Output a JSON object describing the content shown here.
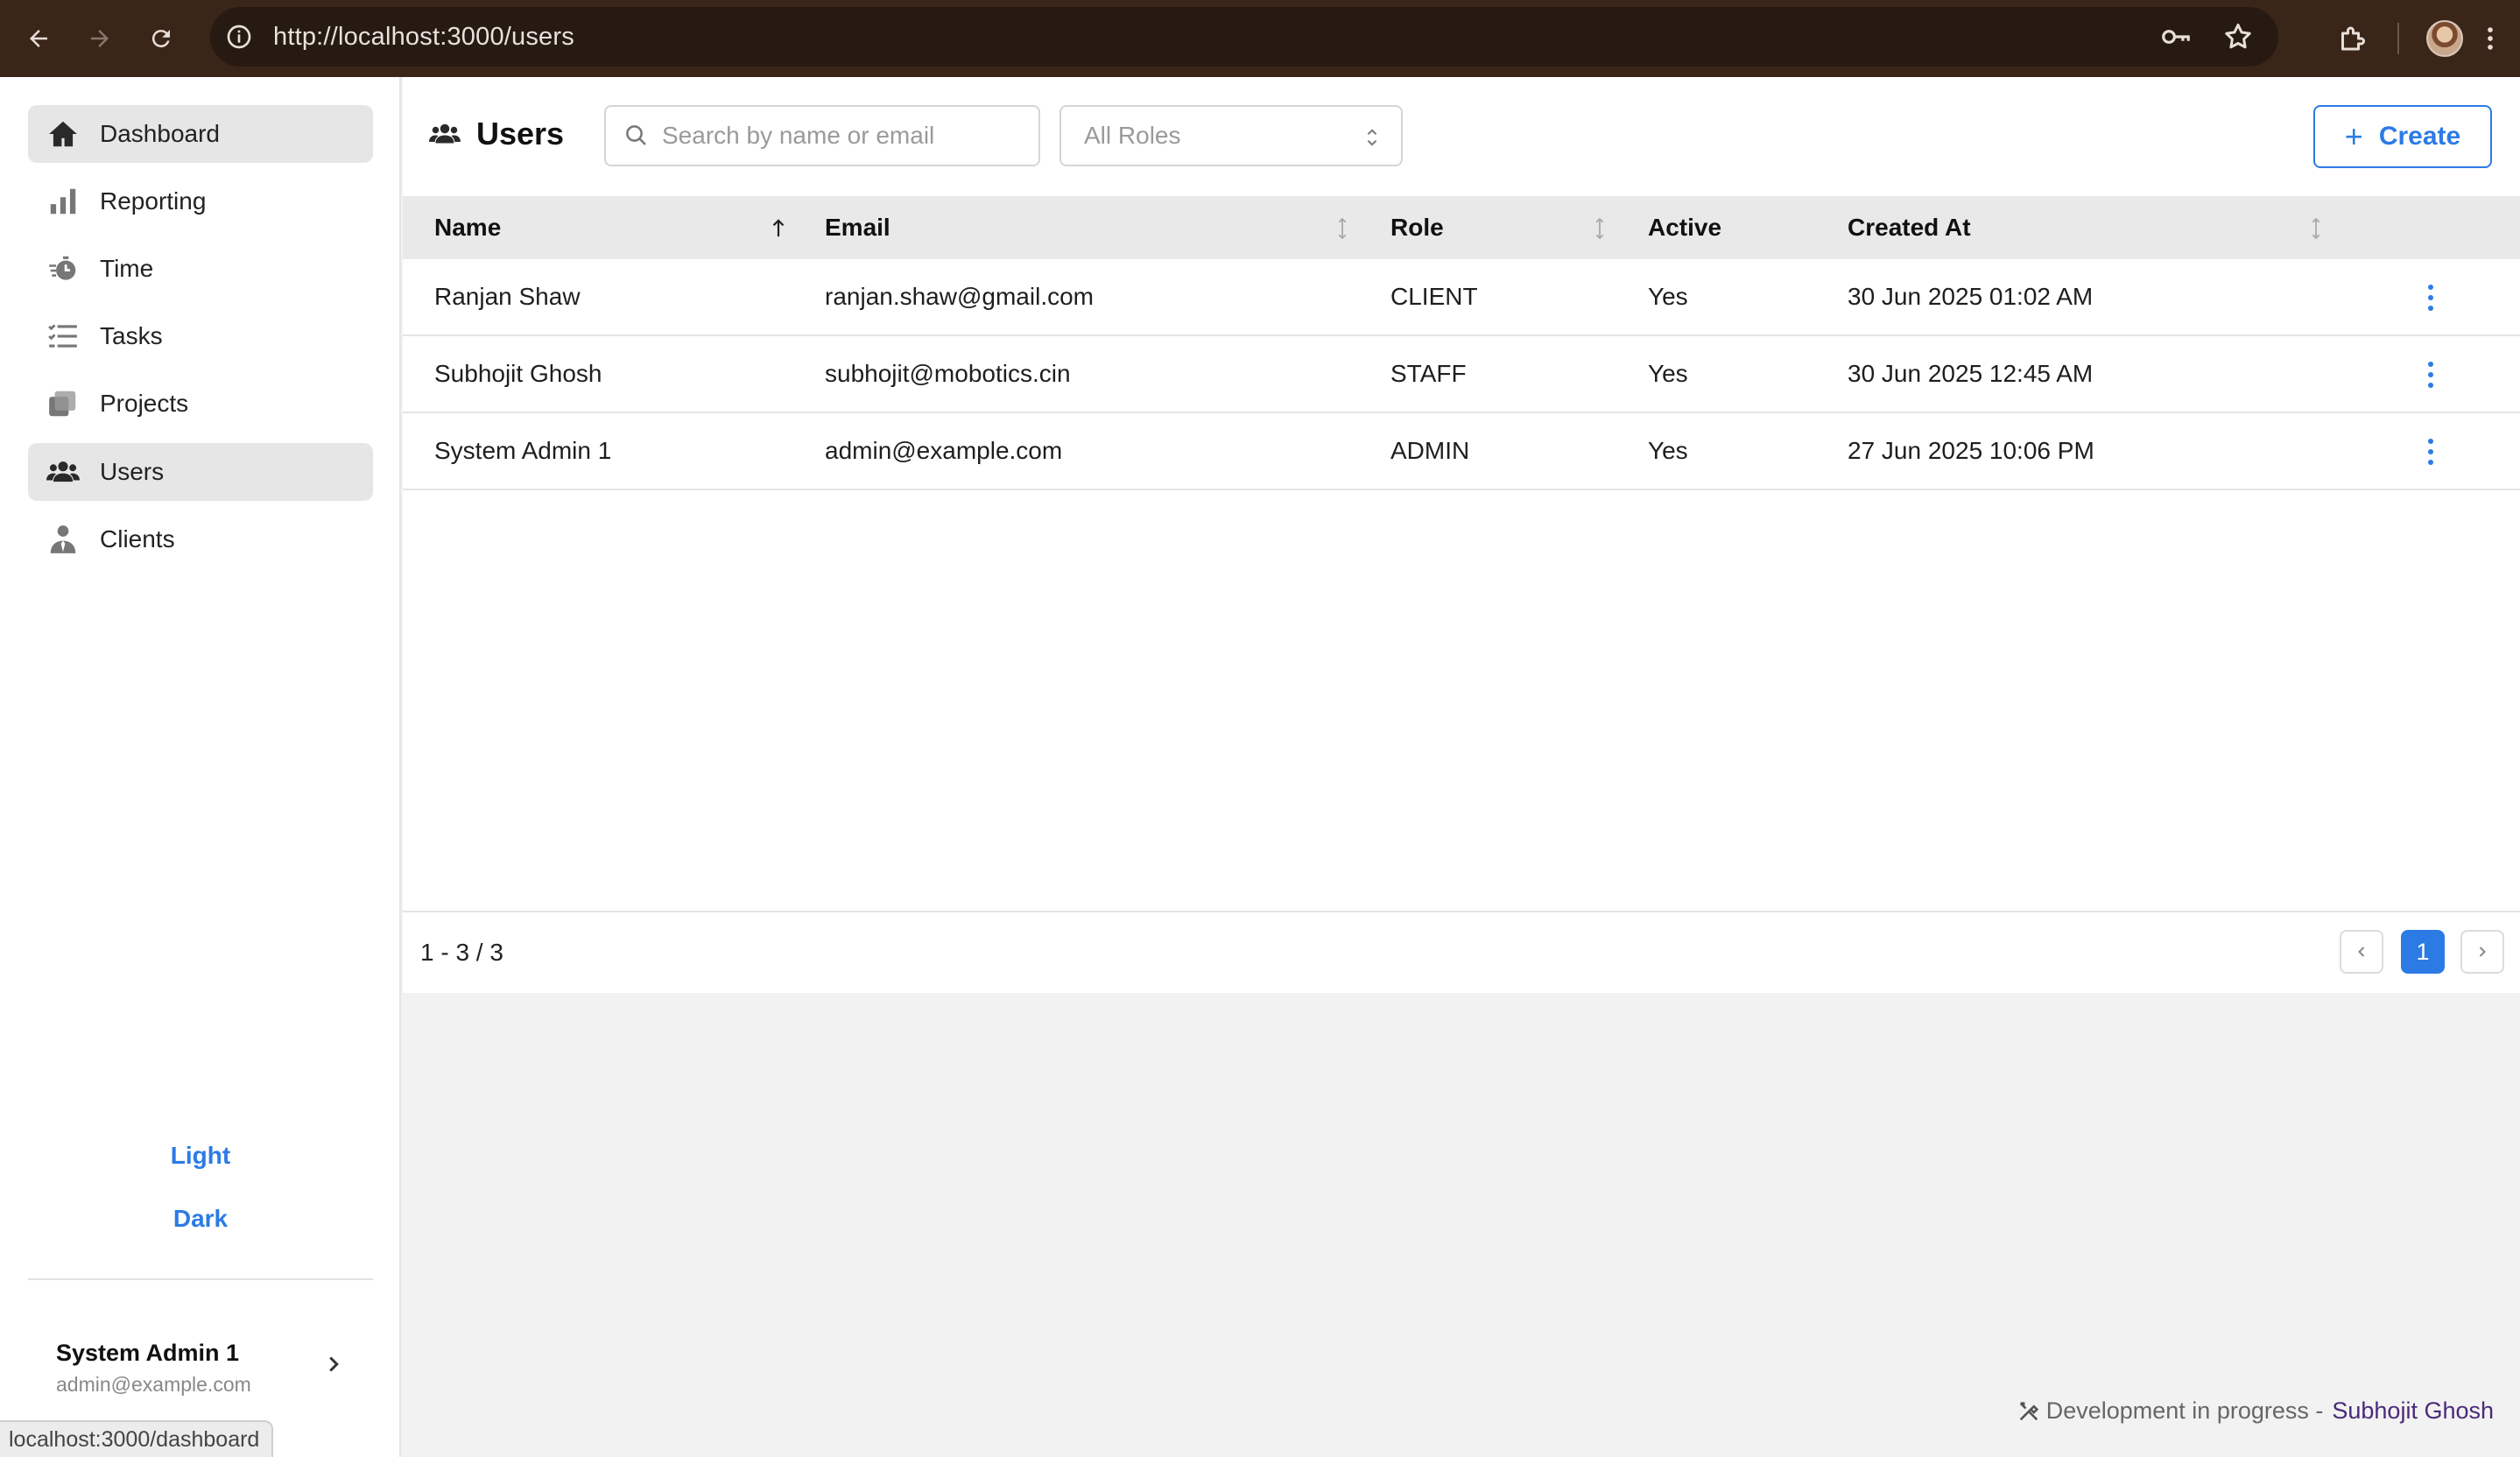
{
  "browser": {
    "url": "http://localhost:3000/users",
    "status_url": "localhost:3000/dashboard"
  },
  "sidebar": {
    "items": [
      {
        "label": "Dashboard",
        "icon": "home-icon"
      },
      {
        "label": "Reporting",
        "icon": "bar-chart-icon"
      },
      {
        "label": "Time",
        "icon": "stopwatch-icon"
      },
      {
        "label": "Tasks",
        "icon": "task-list-icon"
      },
      {
        "label": "Projects",
        "icon": "folders-icon"
      },
      {
        "label": "Users",
        "icon": "users-icon"
      },
      {
        "label": "Clients",
        "icon": "client-icon"
      }
    ],
    "theme_light": "Light",
    "theme_dark": "Dark",
    "user": {
      "name": "System Admin 1",
      "email": "admin@example.com"
    }
  },
  "header": {
    "title": "Users",
    "search_placeholder": "Search by name or email",
    "role_filter": "All Roles",
    "create_label": "Create"
  },
  "table": {
    "columns": [
      "Name",
      "Email",
      "Role",
      "Active",
      "Created At"
    ],
    "rows": [
      {
        "name": "Ranjan Shaw",
        "email": "ranjan.shaw@gmail.com",
        "role": "CLIENT",
        "active": "Yes",
        "created": "30 Jun 2025 01:02 AM"
      },
      {
        "name": "Subhojit Ghosh",
        "email": "subhojit@mobotics.cin",
        "role": "STAFF",
        "active": "Yes",
        "created": "30 Jun 2025 12:45 AM"
      },
      {
        "name": "System Admin 1",
        "email": "admin@example.com",
        "role": "ADMIN",
        "active": "Yes",
        "created": "27 Jun 2025 10:06 PM"
      }
    ]
  },
  "pagination": {
    "range": "1 - 3 / 3",
    "current_page": "1"
  },
  "footer": {
    "note": "Development in progress -",
    "author": "Subhojit Ghosh"
  },
  "colors": {
    "accent": "#2c7be5",
    "chrome": "#3a2519"
  }
}
